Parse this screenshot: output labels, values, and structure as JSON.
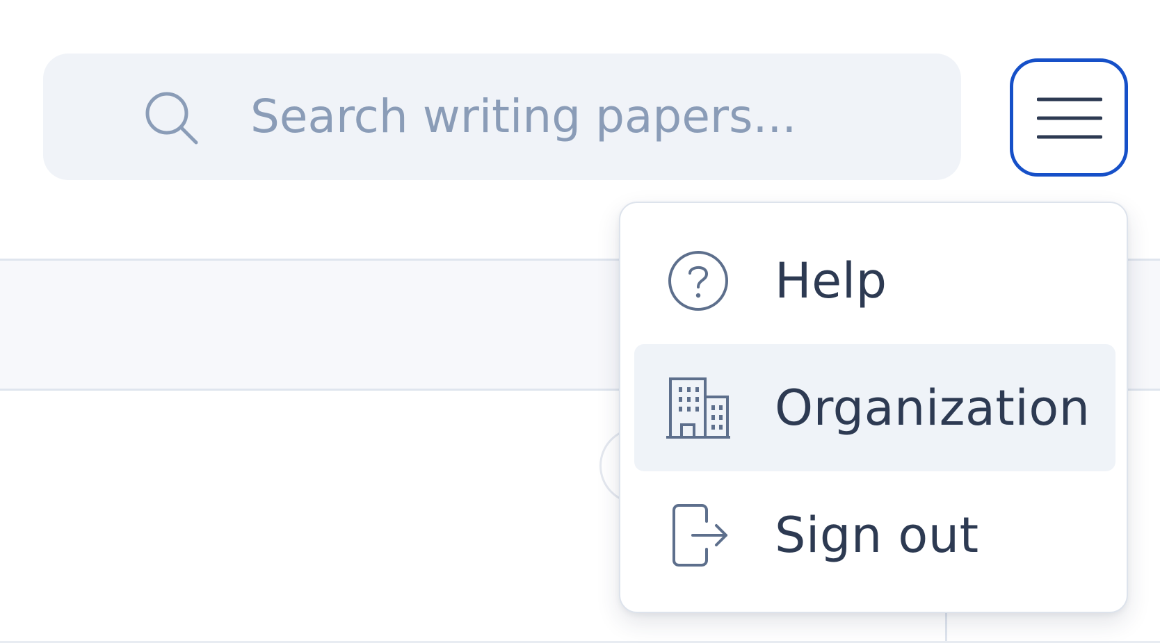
{
  "search": {
    "placeholder": "Search writing papers...",
    "value": "",
    "icon": "search-icon"
  },
  "menu_button": {
    "icon": "hamburger-icon",
    "accent_color": "#1650c8"
  },
  "dropdown": {
    "items": [
      {
        "label": "Help",
        "icon": "help-circle-icon",
        "active": false
      },
      {
        "label": "Organization",
        "icon": "building-icon",
        "active": true
      },
      {
        "label": "Sign out",
        "icon": "sign-out-icon",
        "active": false
      }
    ]
  },
  "colors": {
    "text": "#2d3a52",
    "placeholder": "#8a9cb7",
    "search_bg": "#f0f3f8",
    "active_item_bg": "#eff3f8",
    "icon": "#5d6f8c"
  }
}
